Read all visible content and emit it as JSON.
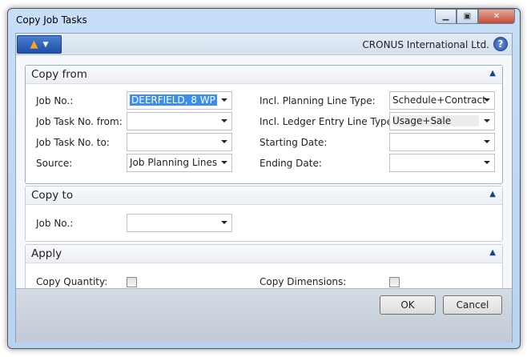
{
  "window": {
    "title": "Copy Job Tasks",
    "company": "CRONUS International Ltd."
  },
  "sections": {
    "copy_from": {
      "title": "Copy from",
      "job_no": {
        "label": "Job No.:",
        "value": "DEERFIELD, 8 WP"
      },
      "task_from": {
        "label": "Job Task No. from:",
        "value": ""
      },
      "task_to": {
        "label": "Job Task No. to:",
        "value": ""
      },
      "source": {
        "label": "Source:",
        "value": "Job Planning Lines"
      },
      "planning_type": {
        "label": "Incl. Planning Line Type:",
        "value": "Schedule+Contract"
      },
      "ledger_type": {
        "label": "Incl. Ledger Entry Line Type:",
        "value": "Usage+Sale"
      },
      "starting_date": {
        "label": "Starting Date:",
        "value": ""
      },
      "ending_date": {
        "label": "Ending Date:",
        "value": ""
      }
    },
    "copy_to": {
      "title": "Copy to",
      "job_no": {
        "label": "Job No.:",
        "value": ""
      }
    },
    "apply": {
      "title": "Apply",
      "copy_quantity": {
        "label": "Copy Quantity:",
        "checked": false
      },
      "copy_dimensions": {
        "label": "Copy Dimensions:",
        "checked": false
      }
    }
  },
  "buttons": {
    "ok": "OK",
    "cancel": "Cancel"
  }
}
